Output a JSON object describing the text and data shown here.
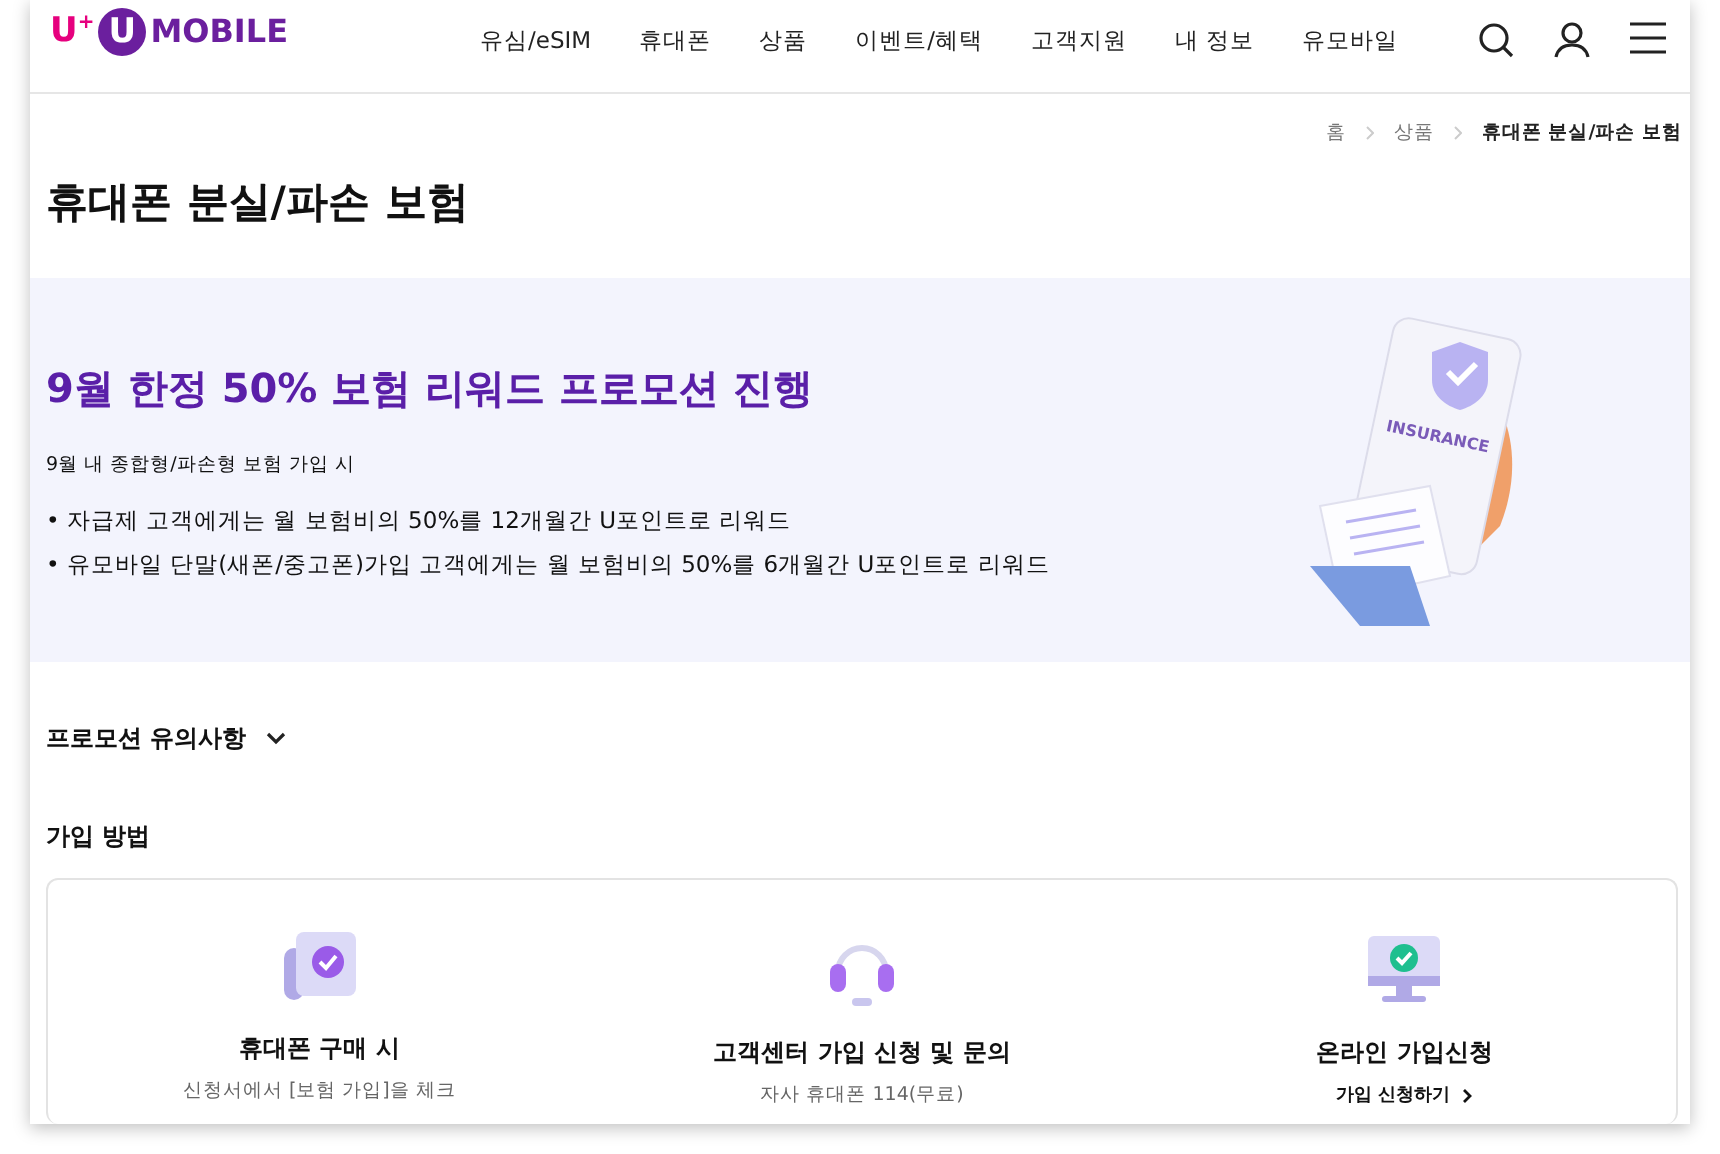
{
  "logo": {
    "prefix": "U",
    "sup": "+",
    "mark": "U",
    "name": "MOBILE"
  },
  "nav": [
    {
      "label": "유심/eSIM"
    },
    {
      "label": "휴대폰"
    },
    {
      "label": "상품"
    },
    {
      "label": "이벤트/혜택"
    },
    {
      "label": "고객지원"
    },
    {
      "label": "내 정보"
    },
    {
      "label": "유모바일"
    }
  ],
  "breadcrumb": [
    {
      "label": "홈",
      "selected": false
    },
    {
      "label": "상품",
      "selected": false
    },
    {
      "label": "휴대폰 분실/파손 보험",
      "selected": true
    }
  ],
  "page_title": "휴대폰 분실/파손 보험",
  "banner": {
    "title": "9월 한정 50% 보험 리워드 프로모션 진행",
    "subtitle": "9월 내 종합형/파손형 보험 가입 시",
    "bullets": [
      "• 자급제 고객에게는 월 보험비의 50%를 12개월간 U포인트로 리워드",
      "• 유모바일 단말(새폰/중고폰)가입 고객에게는 월 보험비의 50%를 6개월간 U포인트로 리워드"
    ],
    "illustration_label": "INSURANCE"
  },
  "notice": {
    "label": "프로모션 유의사항",
    "expanded": false
  },
  "section_title": "가입 방법",
  "methods": [
    {
      "kind": "document",
      "title": "휴대폰 구매 시",
      "lines": [
        "신청서에서 [보험 가입]을 체크"
      ]
    },
    {
      "kind": "headset",
      "title": "고객센터 가입 신청 및 문의",
      "lines": [
        "자사 휴대폰 114(무료)"
      ]
    },
    {
      "kind": "monitor",
      "title": "온라인 가입신청",
      "link": "가입 신청하기"
    }
  ]
}
